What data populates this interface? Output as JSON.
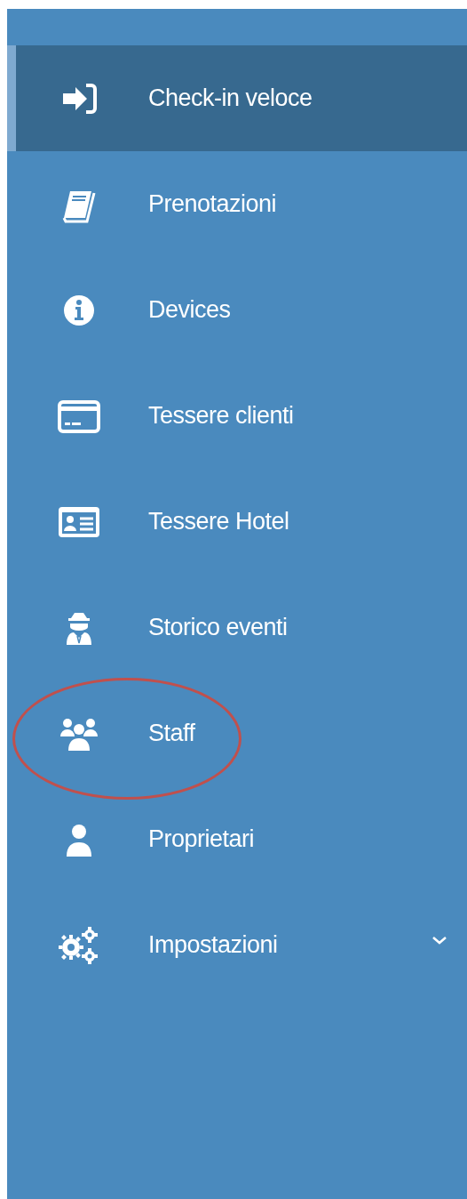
{
  "menu": [
    {
      "label": "Check-in veloce",
      "kind": "link",
      "selected": true,
      "circled": false
    },
    {
      "label": "Prenotazioni",
      "kind": "link",
      "selected": false,
      "circled": false
    },
    {
      "label": "Devices",
      "kind": "link",
      "selected": false,
      "circled": false
    },
    {
      "label": "Tessere clienti",
      "kind": "link",
      "selected": false,
      "circled": false
    },
    {
      "label": "Tessere Hotel",
      "kind": "link",
      "selected": false,
      "circled": false
    },
    {
      "label": "Storico eventi",
      "kind": "link",
      "selected": false,
      "circled": false
    },
    {
      "label": "Staff",
      "kind": "link",
      "selected": false,
      "circled": true
    },
    {
      "label": "Proprietari",
      "kind": "link",
      "selected": false,
      "circled": false
    },
    {
      "label": "Impostazioni",
      "kind": "submenu",
      "selected": false,
      "circled": false
    }
  ]
}
